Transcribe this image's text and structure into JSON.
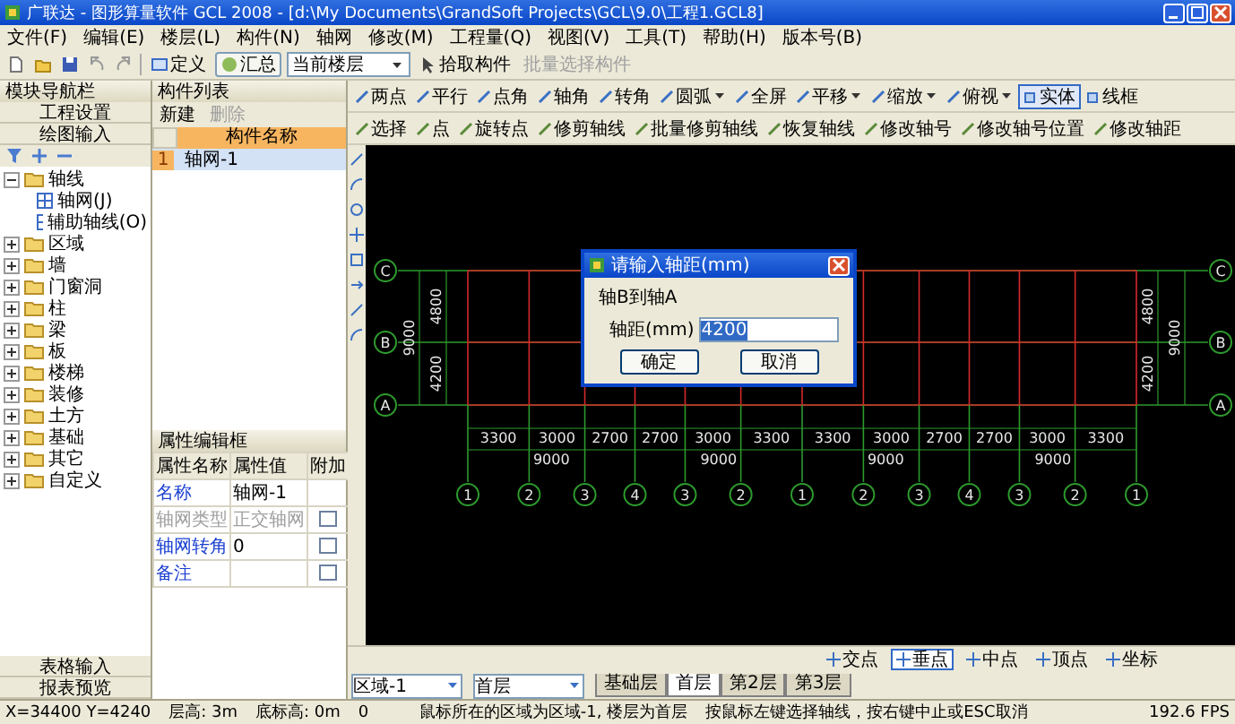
{
  "window": {
    "title": "广联达 - 图形算量软件 GCL 2008 - [d:\\My Documents\\GrandSoft Projects\\GCL\\9.0\\工程1.GCL8]"
  },
  "menu": [
    "文件(F)",
    "编辑(E)",
    "楼层(L)",
    "构件(N)",
    "轴网",
    "修改(M)",
    "工程量(Q)",
    "视图(V)",
    "工具(T)",
    "帮助(H)",
    "版本号(B)"
  ],
  "toolbar": {
    "define": "定义",
    "summary": "汇总",
    "floor_select": "当前楼层",
    "pick": "拾取构件",
    "batch": {
      "label": "批量选择构件",
      "disabled": true
    }
  },
  "draw_tools": [
    {
      "label": "两点",
      "dropdown": false
    },
    {
      "label": "平行",
      "dropdown": false
    },
    {
      "label": "点角",
      "dropdown": false
    },
    {
      "label": "轴角",
      "dropdown": false
    },
    {
      "label": "转角",
      "dropdown": false
    },
    {
      "label": "圆弧",
      "dropdown": true
    },
    {
      "label": "全屏",
      "dropdown": false
    },
    {
      "label": "平移",
      "dropdown": true
    },
    {
      "label": "缩放",
      "dropdown": true
    },
    {
      "label": "俯视",
      "dropdown": true
    }
  ],
  "view_modes": [
    {
      "label": "实体",
      "selected": true
    },
    {
      "label": "线框",
      "selected": false
    }
  ],
  "edit_tools": [
    "选择",
    "点",
    "旋转点",
    "修剪轴线",
    "批量修剪轴线",
    "恢复轴线",
    "修改轴号",
    "修改轴号位置",
    "修改轴距"
  ],
  "navigator": {
    "title": "模块导航栏",
    "sections": [
      "工程设置",
      "绘图输入"
    ],
    "tree": [
      {
        "label": "轴线",
        "expanded": true,
        "children": [
          {
            "label": "轴网(J)"
          },
          {
            "label": "辅助轴线(O)"
          }
        ]
      },
      {
        "label": "区域",
        "expanded": false
      },
      {
        "label": "墙",
        "expanded": false
      },
      {
        "label": "门窗洞",
        "expanded": false
      },
      {
        "label": "柱",
        "expanded": false
      },
      {
        "label": "梁",
        "expanded": false
      },
      {
        "label": "板",
        "expanded": false
      },
      {
        "label": "楼梯",
        "expanded": false
      },
      {
        "label": "装修",
        "expanded": false
      },
      {
        "label": "土方",
        "expanded": false
      },
      {
        "label": "基础",
        "expanded": false
      },
      {
        "label": "其它",
        "expanded": false
      },
      {
        "label": "自定义",
        "expanded": false
      }
    ],
    "footer": [
      "表格输入",
      "报表预览"
    ]
  },
  "component_list": {
    "title": "构件列表",
    "new": "新建",
    "delete": {
      "label": "删除",
      "disabled": true
    },
    "column": "构件名称",
    "rows": [
      {
        "index": "1",
        "name": "轴网-1",
        "selected": true
      }
    ]
  },
  "properties": {
    "title": "属性编辑框",
    "columns": [
      "属性名称",
      "属性值",
      "附加"
    ],
    "rows": [
      {
        "name": "名称",
        "value": "轴网-1",
        "disabled": false
      },
      {
        "name": "轴网类型",
        "value": "正交轴网",
        "disabled": true,
        "attach": false
      },
      {
        "name": "轴网转角",
        "value": "0",
        "disabled": false,
        "attach": false
      },
      {
        "name": "备注",
        "disabled": false,
        "attach": false
      }
    ]
  },
  "canvas": {
    "row_axes_left": [
      "C",
      "B",
      "A"
    ],
    "row_axes_right": [
      "C",
      "B",
      "A"
    ],
    "left_dims": {
      "spacings": [
        "4800",
        "4200"
      ],
      "total": "9000"
    },
    "right_dims": {
      "spacings": [
        "4800",
        "4200"
      ],
      "total": "9000"
    },
    "column_spacings": [
      "3300",
      "3000",
      "2700",
      "2700",
      "3000",
      "3300",
      "3300",
      "3000",
      "2700",
      "2700",
      "3000",
      "3300"
    ],
    "column_totals": [
      "9000",
      "9000",
      "9000",
      "9000"
    ],
    "column_axes": [
      "1",
      "2",
      "3",
      "4",
      "3",
      "2",
      "1",
      "2",
      "3",
      "4",
      "3",
      "2",
      "1"
    ]
  },
  "dialog": {
    "title": "请输入轴距(mm)",
    "message": "轴B到轴A",
    "field_label": "轴距(mm)",
    "value": "4200",
    "buttons": [
      "确定",
      "取消"
    ]
  },
  "snaps": [
    {
      "label": "交点",
      "checked": false
    },
    {
      "label": "垂点",
      "checked": true
    },
    {
      "label": "中点",
      "checked": false
    },
    {
      "label": "顶点",
      "checked": false
    },
    {
      "label": "坐标",
      "checked": false
    }
  ],
  "floor_bar": {
    "region": "区域-1",
    "floor": "首层",
    "tabs": [
      {
        "label": "基础层",
        "selected": false
      },
      {
        "label": "首层",
        "selected": true
      },
      {
        "label": "第2层",
        "selected": false
      },
      {
        "label": "第3层",
        "selected": false
      }
    ]
  },
  "status_bar": [
    "X=34400 Y=4240",
    "层高: 3m",
    "底标高: 0m",
    "0",
    "鼠标所在的区域为区域-1, 楼层为首层",
    "按鼠标左键选择轴线，按右键中止或ESC取消",
    "192.6 FPS"
  ]
}
